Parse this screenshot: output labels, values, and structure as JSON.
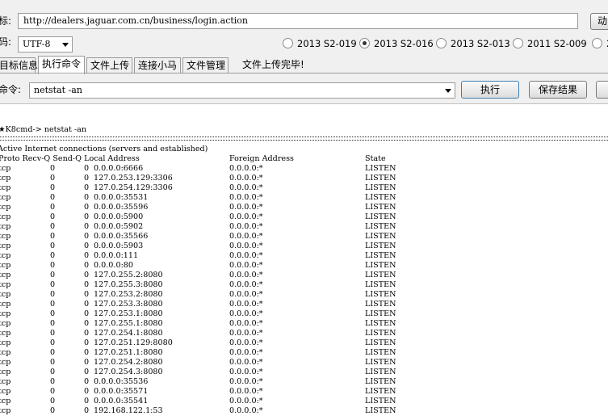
{
  "target": {
    "label": "标:",
    "url": "http://dealers.jaguar.com.cn/business/login.action",
    "button_partial": "动"
  },
  "encoding": {
    "label": "码:",
    "value": "UTF-8"
  },
  "exploit_versions": [
    {
      "label": "2013 S2-019",
      "selected": false
    },
    {
      "label": "2013 S2-016",
      "selected": true
    },
    {
      "label": "2013 S2-013",
      "selected": false
    },
    {
      "label": "2011 S2-009",
      "selected": false
    },
    {
      "label": "2",
      "selected": false
    }
  ],
  "tabs": [
    {
      "label": "目标信息",
      "active": false
    },
    {
      "label": "执行命令",
      "active": true
    },
    {
      "label": "文件上传",
      "active": false
    },
    {
      "label": "连接小马",
      "active": false
    },
    {
      "label": "文件管理",
      "active": false
    }
  ],
  "status_message": "文件上传完毕!",
  "command": {
    "label": "命令:",
    "value": "netstat -an",
    "execute_label": "执行",
    "save_label": "保存结果"
  },
  "console": {
    "prompt": "★K8cmd-> netstat -an",
    "heading": "Active Internet connections (servers and established)",
    "columns": [
      "Proto",
      "Recv-Q",
      "Send-Q",
      "Local Address",
      "Foreign Address",
      "State"
    ],
    "column_header": "Proto Recv-Q Send-Q Local Address",
    "rows": [
      {
        "proto": "tcp",
        "recv": "0",
        "send": "0",
        "local": "0.0.0.0:6666",
        "foreign": "0.0.0.0:*",
        "state": "LISTEN"
      },
      {
        "proto": "tcp",
        "recv": "0",
        "send": "0",
        "local": "127.0.253.129:3306",
        "foreign": "0.0.0.0:*",
        "state": "LISTEN"
      },
      {
        "proto": "tcp",
        "recv": "0",
        "send": "0",
        "local": "127.0.254.129:3306",
        "foreign": "0.0.0.0:*",
        "state": "LISTEN"
      },
      {
        "proto": "tcp",
        "recv": "0",
        "send": "0",
        "local": "0.0.0.0:35531",
        "foreign": "0.0.0.0:*",
        "state": "LISTEN"
      },
      {
        "proto": "tcp",
        "recv": "0",
        "send": "0",
        "local": "0.0.0.0:35596",
        "foreign": "0.0.0.0:*",
        "state": "LISTEN"
      },
      {
        "proto": "tcp",
        "recv": "0",
        "send": "0",
        "local": "0.0.0.0:5900",
        "foreign": "0.0.0.0:*",
        "state": "LISTEN"
      },
      {
        "proto": "tcp",
        "recv": "0",
        "send": "0",
        "local": "0.0.0.0:5902",
        "foreign": "0.0.0.0:*",
        "state": "LISTEN"
      },
      {
        "proto": "tcp",
        "recv": "0",
        "send": "0",
        "local": "0.0.0.0:35566",
        "foreign": "0.0.0.0:*",
        "state": "LISTEN"
      },
      {
        "proto": "tcp",
        "recv": "0",
        "send": "0",
        "local": "0.0.0.0:5903",
        "foreign": "0.0.0.0:*",
        "state": "LISTEN"
      },
      {
        "proto": "tcp",
        "recv": "0",
        "send": "0",
        "local": "0.0.0.0:111",
        "foreign": "0.0.0.0:*",
        "state": "LISTEN"
      },
      {
        "proto": "tcp",
        "recv": "0",
        "send": "0",
        "local": "0.0.0.0:80",
        "foreign": "0.0.0.0:*",
        "state": "LISTEN"
      },
      {
        "proto": "tcp",
        "recv": "0",
        "send": "0",
        "local": "127.0.255.2:8080",
        "foreign": "0.0.0.0:*",
        "state": "LISTEN"
      },
      {
        "proto": "tcp",
        "recv": "0",
        "send": "0",
        "local": "127.0.255.3:8080",
        "foreign": "0.0.0.0:*",
        "state": "LISTEN"
      },
      {
        "proto": "tcp",
        "recv": "0",
        "send": "0",
        "local": "127.0.253.2:8080",
        "foreign": "0.0.0.0:*",
        "state": "LISTEN"
      },
      {
        "proto": "tcp",
        "recv": "0",
        "send": "0",
        "local": "127.0.253.3:8080",
        "foreign": "0.0.0.0:*",
        "state": "LISTEN"
      },
      {
        "proto": "tcp",
        "recv": "0",
        "send": "0",
        "local": "127.0.253.1:8080",
        "foreign": "0.0.0.0:*",
        "state": "LISTEN"
      },
      {
        "proto": "tcp",
        "recv": "0",
        "send": "0",
        "local": "127.0.255.1:8080",
        "foreign": "0.0.0.0:*",
        "state": "LISTEN"
      },
      {
        "proto": "tcp",
        "recv": "0",
        "send": "0",
        "local": "127.0.254.1:8080",
        "foreign": "0.0.0.0:*",
        "state": "LISTEN"
      },
      {
        "proto": "tcp",
        "recv": "0",
        "send": "0",
        "local": "127.0.251.129:8080",
        "foreign": "0.0.0.0:*",
        "state": "LISTEN"
      },
      {
        "proto": "tcp",
        "recv": "0",
        "send": "0",
        "local": "127.0.251.1:8080",
        "foreign": "0.0.0.0:*",
        "state": "LISTEN"
      },
      {
        "proto": "tcp",
        "recv": "0",
        "send": "0",
        "local": "127.0.254.2:8080",
        "foreign": "0.0.0.0:*",
        "state": "LISTEN"
      },
      {
        "proto": "tcp",
        "recv": "0",
        "send": "0",
        "local": "127.0.254.3:8080",
        "foreign": "0.0.0.0:*",
        "state": "LISTEN"
      },
      {
        "proto": "tcp",
        "recv": "0",
        "send": "0",
        "local": "0.0.0.0:35536",
        "foreign": "0.0.0.0:*",
        "state": "LISTEN"
      },
      {
        "proto": "tcp",
        "recv": "0",
        "send": "0",
        "local": "0.0.0.0:35571",
        "foreign": "0.0.0.0:*",
        "state": "LISTEN"
      },
      {
        "proto": "tcp",
        "recv": "0",
        "send": "0",
        "local": "0.0.0.0:35541",
        "foreign": "0.0.0.0:*",
        "state": "LISTEN"
      },
      {
        "proto": "tcp",
        "recv": "0",
        "send": "0",
        "local": "192.168.122.1:53",
        "foreign": "0.0.0.0:*",
        "state": "LISTEN"
      }
    ]
  }
}
